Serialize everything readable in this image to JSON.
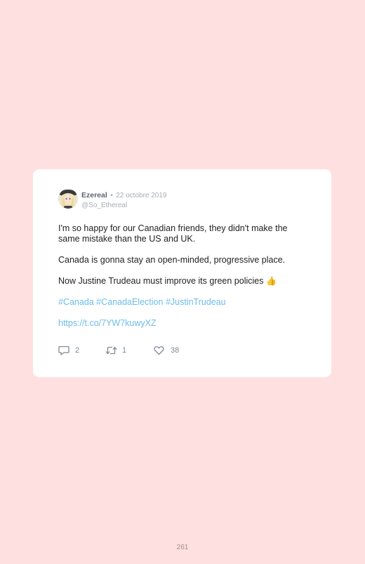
{
  "tweet": {
    "author_name": "Ezereal",
    "separator": "•",
    "date": "22 octobre 2019",
    "handle": "@So_Ethereal",
    "paragraphs": {
      "p1": "I'm so happy for our Canadian friends, they didn't make the same mistake than the US and UK.",
      "p2": "Canada is gonna stay an open-minded, progressive place.",
      "p3": "Now Justine Trudeau must improve its green policies",
      "p3_emoji": "👍"
    },
    "hashtags": [
      "#Canada",
      "#CanadaElection",
      "#JustinTrudeau"
    ],
    "link": "https://t.co/7YW7kuwyXZ",
    "stats": {
      "replies": "2",
      "retweets": "1",
      "likes": "38"
    }
  },
  "page": {
    "number": "261"
  },
  "colors": {
    "background": "#ffe0e0",
    "card": "#ffffff",
    "link": "#6bbde8",
    "text": "#222222",
    "muted": "#a6adb4"
  },
  "icons": {
    "reply": "reply-icon",
    "retweet": "retweet-icon",
    "like": "heart-icon"
  }
}
